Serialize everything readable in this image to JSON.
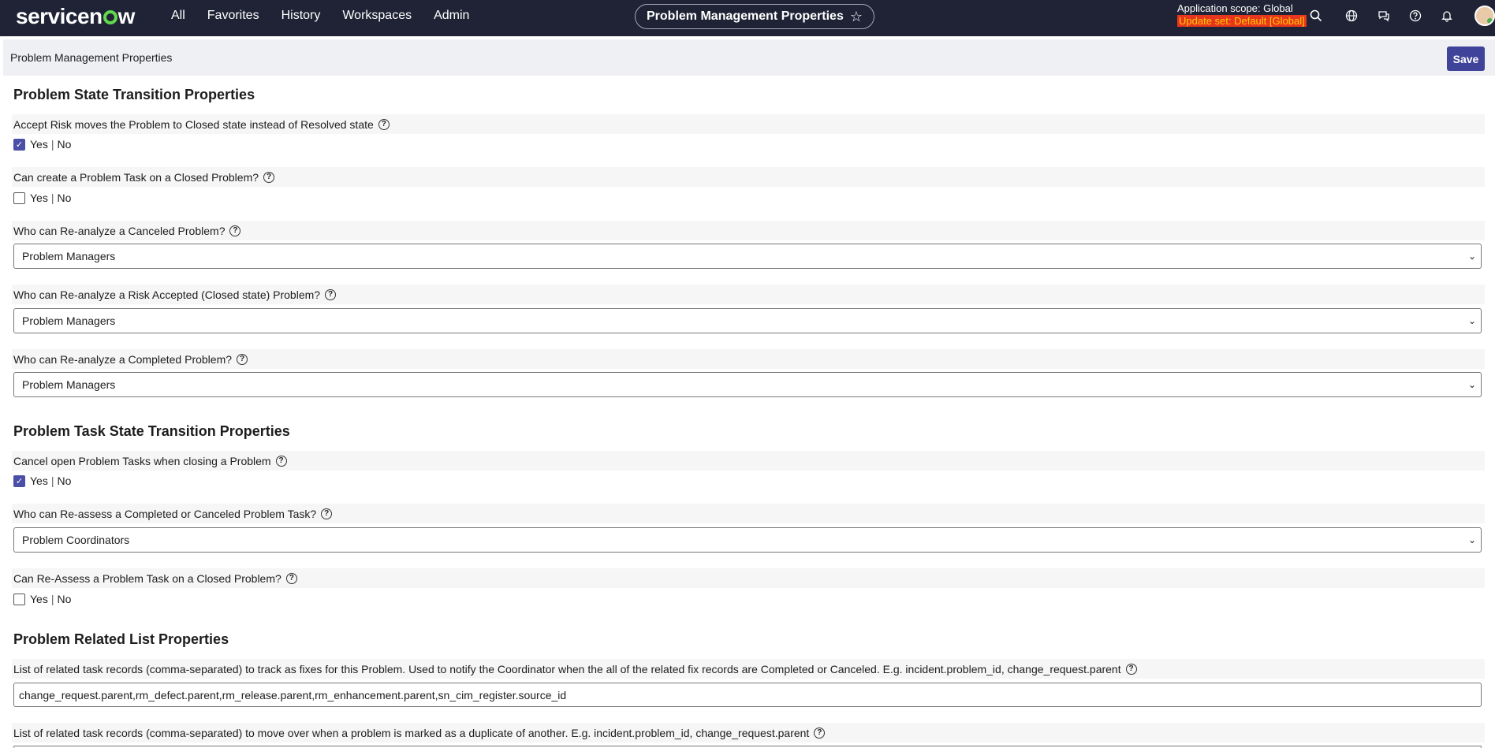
{
  "topbar": {
    "logo_before": "servicen",
    "logo_after": "w",
    "nav": [
      "All",
      "Favorites",
      "History",
      "Workspaces",
      "Admin"
    ],
    "title": "Problem Management Properties",
    "scope_label": "Application scope: Global",
    "update_set": "Update set: Default [Global]"
  },
  "header": {
    "title": "Problem Management Properties",
    "save_label": "Save"
  },
  "sections": [
    {
      "title": "Problem State Transition Properties"
    },
    {
      "title": "Problem Task State Transition Properties"
    },
    {
      "title": "Problem Related List Properties"
    }
  ],
  "yes": "Yes",
  "no": "No",
  "separator": "|",
  "properties": [
    {
      "label": "Accept Risk moves the Problem to Closed state instead of Resolved state",
      "checked": true
    },
    {
      "label": "Can create a Problem Task on a Closed Problem?",
      "checked": false
    },
    {
      "label": "Who can Re-analyze a Canceled Problem?",
      "value": "Problem Managers"
    },
    {
      "label": "Who can Re-analyze a Risk Accepted (Closed state) Problem?",
      "value": "Problem Managers"
    },
    {
      "label": "Who can Re-analyze a Completed Problem?",
      "value": "Problem Managers"
    },
    {
      "label": "Cancel open Problem Tasks when closing a Problem",
      "checked": true
    },
    {
      "label": "Who can Re-assess a Completed or Canceled Problem Task?",
      "value": "Problem Coordinators"
    },
    {
      "label": "Can Re-Assess a Problem Task on a Closed Problem?",
      "checked": false
    },
    {
      "label": "List of related task records (comma-separated) to track as fixes for this Problem. Used to notify the Coordinator when the all of the related fix records are Completed or Canceled. E.g. incident.problem_id, change_request.parent",
      "value": "change_request.parent,rm_defect.parent,rm_release.parent,rm_enhancement.parent,sn_cim_register.source_id"
    },
    {
      "label": "List of related task records (comma-separated) to move over when a problem is marked as a duplicate of another. E.g. incident.problem_id, change_request.parent"
    }
  ],
  "help_glyph": "?",
  "check_glyph": "✓",
  "chevron_glyph": "⌄",
  "colors": {
    "topbar": "#1f2335",
    "accent": "#3f4399",
    "update_set_bg": "#e8351d",
    "update_set_fg": "#ffcc00"
  }
}
